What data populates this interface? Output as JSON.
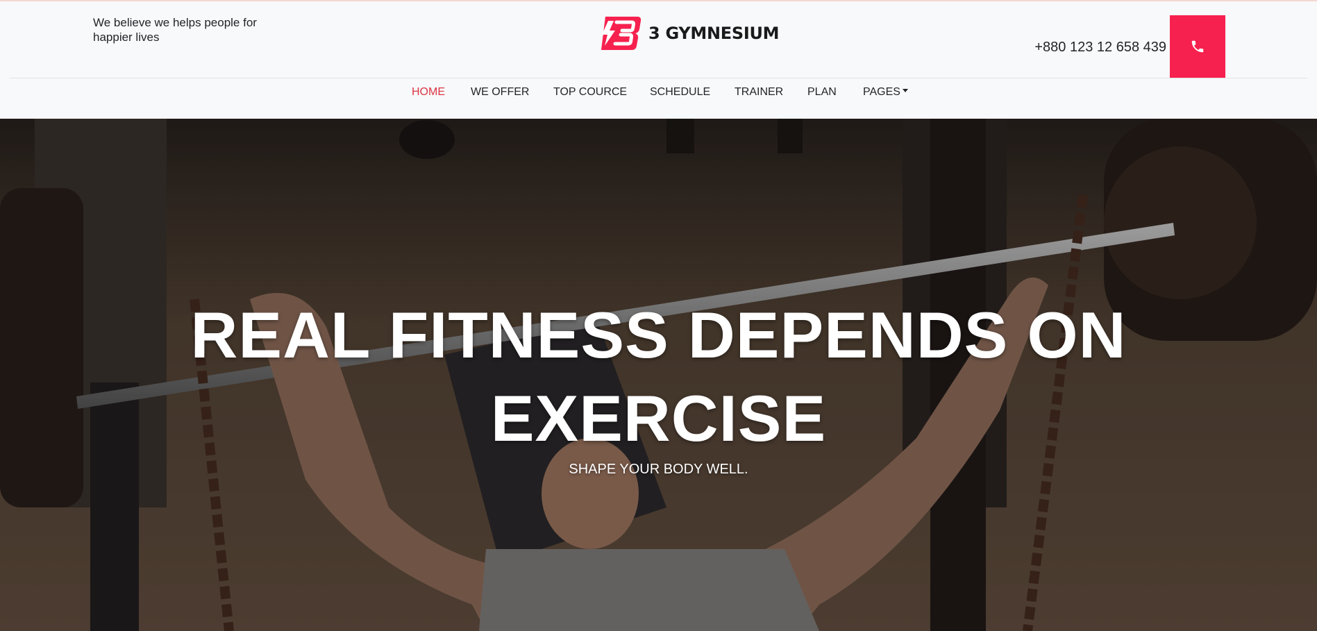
{
  "header": {
    "tagline": "We believe we helps people for happier lives",
    "brand_name": "3 GYMNESIUM",
    "phone_number": "+880 123 12 658 439",
    "accent_color": "#f6214e"
  },
  "nav": {
    "items": [
      {
        "label": "HOME",
        "active": true
      },
      {
        "label": "WE OFFER"
      },
      {
        "label": "TOP COURCE"
      },
      {
        "label": "SCHEDULE"
      },
      {
        "label": "TRAINER"
      },
      {
        "label": "PLAN"
      },
      {
        "label": "PAGES",
        "dropdown": true
      }
    ]
  },
  "hero": {
    "title": "REAL FITNESS DEPENDS ON EXERCISE",
    "subtitle": "SHAPE YOUR BODY WELL.",
    "image_description_icon": "man-bench-press-outdoor-photo"
  },
  "icons": {
    "logo": "brand-logo-icon",
    "phone": "phone-icon",
    "caret": "caret-down-icon"
  }
}
